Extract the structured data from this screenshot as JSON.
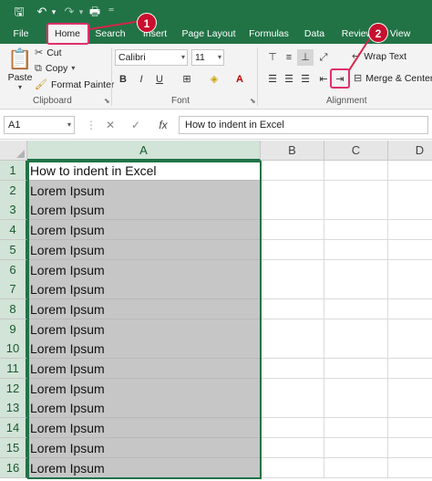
{
  "colors": {
    "accent": "#217346",
    "callout": "#c8102e",
    "selection_fill": "#c6c6c6"
  },
  "qat": [
    {
      "name": "save-icon",
      "glyph": "🖫"
    },
    {
      "name": "undo-icon",
      "glyph": "↶"
    },
    {
      "name": "undo-dropdown-icon",
      "glyph": "▾"
    },
    {
      "name": "redo-icon",
      "glyph": "↷"
    },
    {
      "name": "redo-dropdown-icon",
      "glyph": "▾"
    },
    {
      "name": "quick-print-icon",
      "glyph": "🖶"
    },
    {
      "name": "customize-qat-icon",
      "glyph": "⁼"
    }
  ],
  "tabs": [
    "File",
    "Home",
    "Search",
    "Insert",
    "Page Layout",
    "Formulas",
    "Data",
    "Review",
    "View"
  ],
  "ribbon": {
    "clipboard": {
      "paste": "Paste",
      "cut": "Cut",
      "copy": "Copy",
      "format_painter": "Format Painter",
      "label": "Clipboard"
    },
    "font": {
      "family": "Calibri",
      "size": "11",
      "label": "Font",
      "bold": "B",
      "italic": "I",
      "underline": "U"
    },
    "alignment": {
      "wrap_text": "Wrap Text",
      "merge_center": "Merge & Center",
      "label": "Alignment"
    }
  },
  "callouts": {
    "one": "1",
    "two": "2"
  },
  "formula_bar": {
    "name_box": "A1",
    "cancel": "✕",
    "enter": "✓",
    "fx": "fx",
    "content": "How to indent in Excel"
  },
  "sheet": {
    "columns": [
      "A",
      "B",
      "C",
      "D"
    ],
    "rows": [
      {
        "n": "1",
        "a": "How to indent in Excel"
      },
      {
        "n": "2",
        "a": "Lorem Ipsum"
      },
      {
        "n": "3",
        "a": "Lorem Ipsum"
      },
      {
        "n": "4",
        "a": "Lorem Ipsum"
      },
      {
        "n": "5",
        "a": "Lorem Ipsum"
      },
      {
        "n": "6",
        "a": "Lorem Ipsum"
      },
      {
        "n": "7",
        "a": "Lorem Ipsum"
      },
      {
        "n": "8",
        "a": "Lorem Ipsum"
      },
      {
        "n": "9",
        "a": "Lorem Ipsum"
      },
      {
        "n": "10",
        "a": "Lorem Ipsum"
      },
      {
        "n": "11",
        "a": "Lorem Ipsum"
      },
      {
        "n": "12",
        "a": "Lorem Ipsum"
      },
      {
        "n": "13",
        "a": "Lorem Ipsum"
      },
      {
        "n": "14",
        "a": "Lorem Ipsum"
      },
      {
        "n": "15",
        "a": "Lorem Ipsum"
      },
      {
        "n": "16",
        "a": "Lorem Ipsum"
      }
    ]
  }
}
